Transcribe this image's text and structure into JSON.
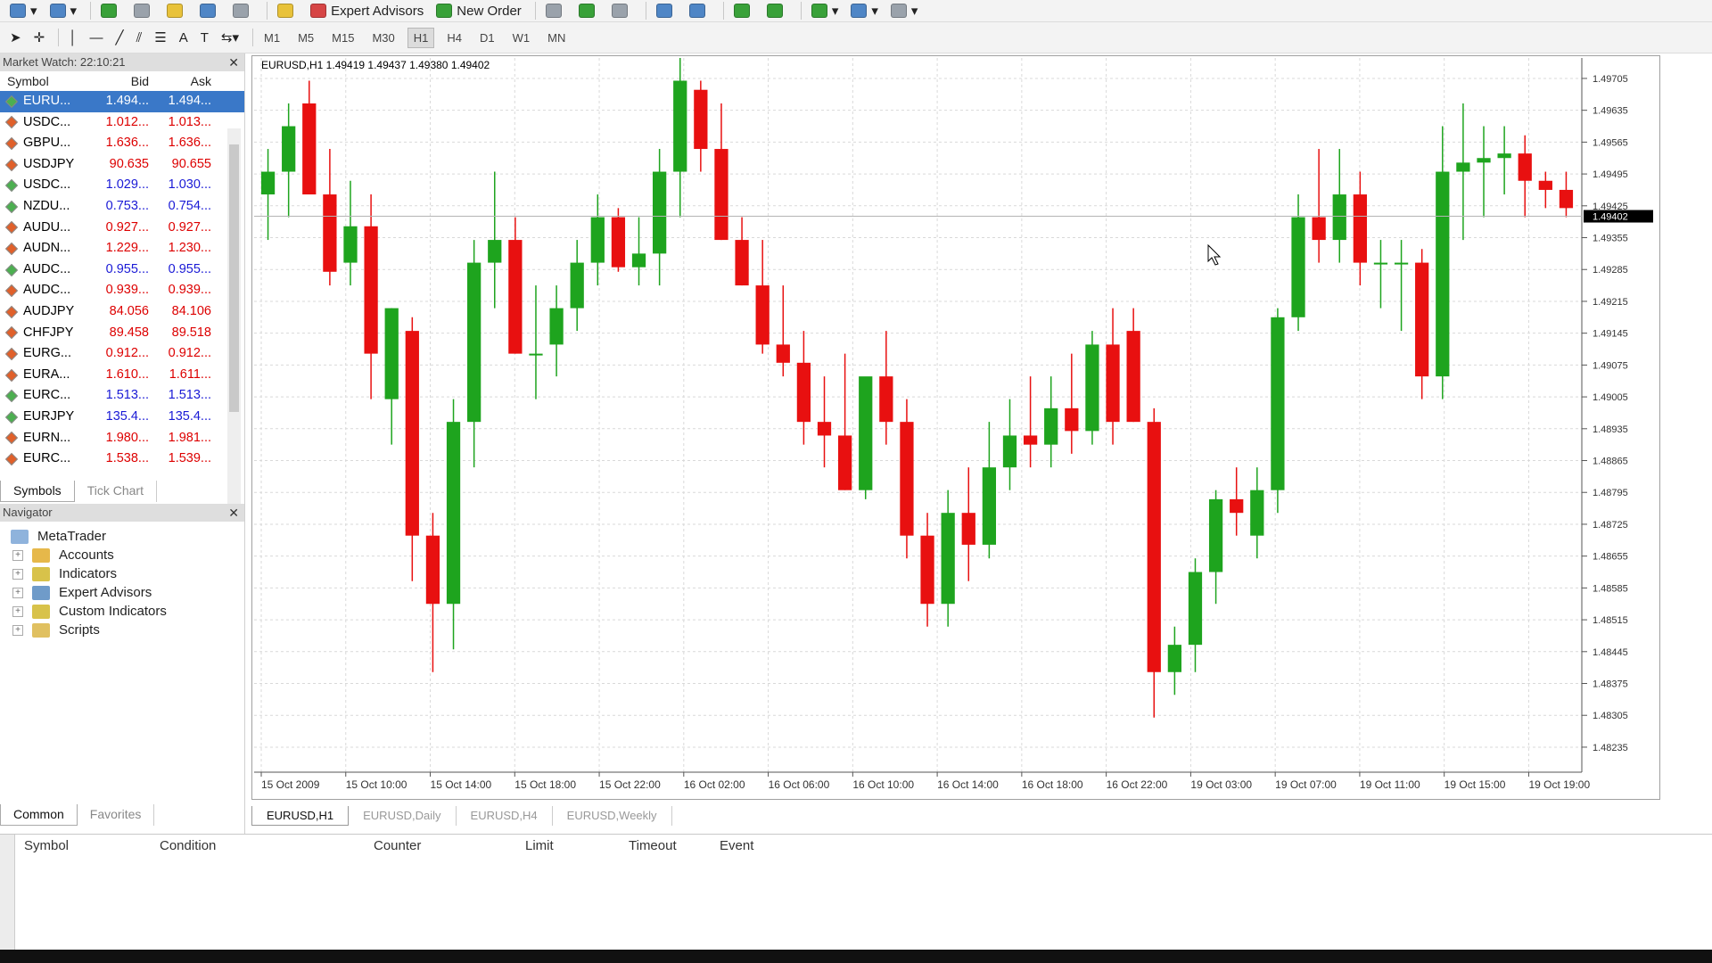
{
  "toolbar1": {
    "expert_advisors_label": "Expert Advisors",
    "new_order_label": "New Order"
  },
  "toolbar2": {
    "timeframes": [
      "M1",
      "M5",
      "M15",
      "M30",
      "H1",
      "H4",
      "D1",
      "W1",
      "MN"
    ],
    "active_timeframe": "H1"
  },
  "market_watch": {
    "title": "Market Watch: 22:10:21",
    "col_symbol": "Symbol",
    "col_bid": "Bid",
    "col_ask": "Ask",
    "rows": [
      {
        "symbol": "EURU...",
        "bid": "1.494...",
        "ask": "1.494...",
        "dir": "up",
        "selected": true
      },
      {
        "symbol": "USDC...",
        "bid": "1.012...",
        "ask": "1.013...",
        "dir": "dn"
      },
      {
        "symbol": "GBPU...",
        "bid": "1.636...",
        "ask": "1.636...",
        "dir": "dn"
      },
      {
        "symbol": "USDJPY",
        "bid": "90.635",
        "ask": "90.655",
        "dir": "dn"
      },
      {
        "symbol": "USDC...",
        "bid": "1.029...",
        "ask": "1.030...",
        "dir": "up"
      },
      {
        "symbol": "NZDU...",
        "bid": "0.753...",
        "ask": "0.754...",
        "dir": "up"
      },
      {
        "symbol": "AUDU...",
        "bid": "0.927...",
        "ask": "0.927...",
        "dir": "dn"
      },
      {
        "symbol": "AUDN...",
        "bid": "1.229...",
        "ask": "1.230...",
        "dir": "dn"
      },
      {
        "symbol": "AUDC...",
        "bid": "0.955...",
        "ask": "0.955...",
        "dir": "up"
      },
      {
        "symbol": "AUDC...",
        "bid": "0.939...",
        "ask": "0.939...",
        "dir": "dn"
      },
      {
        "symbol": "AUDJPY",
        "bid": "84.056",
        "ask": "84.106",
        "dir": "dn"
      },
      {
        "symbol": "CHFJPY",
        "bid": "89.458",
        "ask": "89.518",
        "dir": "dn"
      },
      {
        "symbol": "EURG...",
        "bid": "0.912...",
        "ask": "0.912...",
        "dir": "dn"
      },
      {
        "symbol": "EURA...",
        "bid": "1.610...",
        "ask": "1.611...",
        "dir": "dn"
      },
      {
        "symbol": "EURC...",
        "bid": "1.513...",
        "ask": "1.513...",
        "dir": "up"
      },
      {
        "symbol": "EURJPY",
        "bid": "135.4...",
        "ask": "135.4...",
        "dir": "up"
      },
      {
        "symbol": "EURN...",
        "bid": "1.980...",
        "ask": "1.981...",
        "dir": "dn"
      },
      {
        "symbol": "EURC...",
        "bid": "1.538...",
        "ask": "1.539...",
        "dir": "dn"
      }
    ],
    "tabs": [
      "Symbols",
      "Tick Chart"
    ]
  },
  "navigator": {
    "title": "Navigator",
    "root": "MetaTrader",
    "items": [
      "Accounts",
      "Indicators",
      "Expert Advisors",
      "Custom Indicators",
      "Scripts"
    ],
    "tabs": [
      "Common",
      "Favorites"
    ]
  },
  "chart": {
    "header": "EURUSD,H1  1.49419 1.49437 1.49380 1.49402",
    "current_price": "1.49402",
    "tabs": [
      "EURUSD,H1",
      "EURUSD,Daily",
      "EURUSD,H4",
      "EURUSD,Weekly"
    ]
  },
  "chart_data": {
    "type": "candlestick",
    "symbol": "EURUSD",
    "timeframe": "H1",
    "ylim": [
      1.4818,
      1.4975
    ],
    "y_ticks": [
      "1.49705",
      "1.49635",
      "1.49565",
      "1.49495",
      "1.49425",
      "1.49355",
      "1.49285",
      "1.49215",
      "1.49145",
      "1.49075",
      "1.49005",
      "1.48935",
      "1.48865",
      "1.48795",
      "1.48725",
      "1.48655",
      "1.48585",
      "1.48515",
      "1.48445",
      "1.48375",
      "1.48305",
      "1.48235"
    ],
    "x_ticks": [
      "15 Oct 2009",
      "15 Oct 10:00",
      "15 Oct 14:00",
      "15 Oct 18:00",
      "15 Oct 22:00",
      "16 Oct 02:00",
      "16 Oct 06:00",
      "16 Oct 10:00",
      "16 Oct 14:00",
      "16 Oct 18:00",
      "16 Oct 22:00",
      "19 Oct 03:00",
      "19 Oct 07:00",
      "19 Oct 11:00",
      "19 Oct 15:00",
      "19 Oct 19:00"
    ],
    "grid": true,
    "candles": [
      [
        1.4945,
        1.4955,
        1.4935,
        1.495
      ],
      [
        1.495,
        1.4965,
        1.494,
        1.496
      ],
      [
        1.4965,
        1.497,
        1.495,
        1.4945
      ],
      [
        1.4945,
        1.4955,
        1.4925,
        1.4928
      ],
      [
        1.493,
        1.4948,
        1.4925,
        1.4938
      ],
      [
        1.4938,
        1.4945,
        1.49,
        1.491
      ],
      [
        1.49,
        1.492,
        1.489,
        1.492
      ],
      [
        1.4915,
        1.4918,
        1.486,
        1.487
      ],
      [
        1.487,
        1.4875,
        1.484,
        1.4855
      ],
      [
        1.4855,
        1.49,
        1.4845,
        1.4895
      ],
      [
        1.4895,
        1.4935,
        1.4885,
        1.493
      ],
      [
        1.493,
        1.495,
        1.492,
        1.4935
      ],
      [
        1.4935,
        1.494,
        1.491,
        1.491
      ],
      [
        1.491,
        1.4925,
        1.49,
        1.491
      ],
      [
        1.4912,
        1.4925,
        1.4905,
        1.492
      ],
      [
        1.492,
        1.4935,
        1.4915,
        1.493
      ],
      [
        1.493,
        1.4945,
        1.4925,
        1.494
      ],
      [
        1.494,
        1.4942,
        1.4928,
        1.4929
      ],
      [
        1.4929,
        1.494,
        1.4925,
        1.4932
      ],
      [
        1.4932,
        1.4955,
        1.4925,
        1.495
      ],
      [
        1.495,
        1.4975,
        1.494,
        1.497
      ],
      [
        1.4968,
        1.497,
        1.495,
        1.4955
      ],
      [
        1.4955,
        1.4965,
        1.4935,
        1.4935
      ],
      [
        1.4935,
        1.494,
        1.4925,
        1.4925
      ],
      [
        1.4925,
        1.4935,
        1.491,
        1.4912
      ],
      [
        1.4912,
        1.4925,
        1.4905,
        1.4908
      ],
      [
        1.4908,
        1.4915,
        1.489,
        1.4895
      ],
      [
        1.4895,
        1.4905,
        1.4885,
        1.4892
      ],
      [
        1.4892,
        1.491,
        1.488,
        1.488
      ],
      [
        1.488,
        1.49,
        1.4878,
        1.4905
      ],
      [
        1.4905,
        1.4915,
        1.489,
        1.4895
      ],
      [
        1.4895,
        1.49,
        1.4865,
        1.487
      ],
      [
        1.487,
        1.4875,
        1.485,
        1.4855
      ],
      [
        1.4855,
        1.488,
        1.485,
        1.4875
      ],
      [
        1.4875,
        1.4885,
        1.486,
        1.4868
      ],
      [
        1.4868,
        1.4895,
        1.4865,
        1.4885
      ],
      [
        1.4885,
        1.49,
        1.488,
        1.4892
      ],
      [
        1.4892,
        1.4905,
        1.4885,
        1.489
      ],
      [
        1.489,
        1.4905,
        1.4885,
        1.4898
      ],
      [
        1.4898,
        1.491,
        1.4888,
        1.4893
      ],
      [
        1.4893,
        1.4915,
        1.489,
        1.4912
      ],
      [
        1.4912,
        1.492,
        1.489,
        1.4895
      ],
      [
        1.4915,
        1.492,
        1.4895,
        1.4895
      ],
      [
        1.4895,
        1.4898,
        1.483,
        1.484
      ],
      [
        1.484,
        1.485,
        1.4835,
        1.4846
      ],
      [
        1.4846,
        1.4865,
        1.484,
        1.4862
      ],
      [
        1.4862,
        1.488,
        1.4855,
        1.4878
      ],
      [
        1.4878,
        1.4885,
        1.487,
        1.4875
      ],
      [
        1.487,
        1.4885,
        1.4865,
        1.488
      ],
      [
        1.488,
        1.492,
        1.4875,
        1.4918
      ],
      [
        1.4918,
        1.4945,
        1.4915,
        1.494
      ],
      [
        1.494,
        1.4955,
        1.493,
        1.4935
      ],
      [
        1.4935,
        1.4955,
        1.493,
        1.4945
      ],
      [
        1.4945,
        1.495,
        1.4925,
        1.493
      ],
      [
        1.493,
        1.4935,
        1.492,
        1.493
      ],
      [
        1.493,
        1.4935,
        1.4915,
        1.493
      ],
      [
        1.493,
        1.4933,
        1.49,
        1.4905
      ],
      [
        1.4905,
        1.496,
        1.49,
        1.495
      ],
      [
        1.495,
        1.4965,
        1.4935,
        1.4952
      ],
      [
        1.4952,
        1.496,
        1.494,
        1.4953
      ],
      [
        1.4953,
        1.496,
        1.4945,
        1.4954
      ],
      [
        1.4954,
        1.4958,
        1.494,
        1.4948
      ],
      [
        1.4948,
        1.495,
        1.4942,
        1.4946
      ],
      [
        1.4946,
        1.495,
        1.494,
        1.4942
      ]
    ]
  },
  "terminal": {
    "columns": [
      "Symbol",
      "Condition",
      "Counter",
      "Limit",
      "Timeout",
      "Event"
    ]
  },
  "colors": {
    "bull": "#1ea41e",
    "bear": "#e81010",
    "selection": "#3a78c8"
  }
}
